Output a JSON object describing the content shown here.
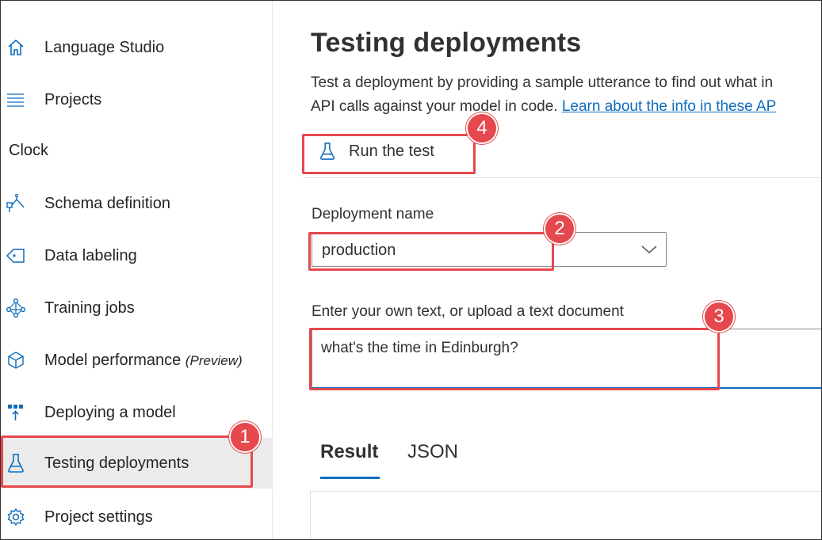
{
  "sidebar": {
    "items": [
      {
        "label": "Language Studio",
        "icon": "home-icon"
      },
      {
        "label": "Projects",
        "icon": "list-icon"
      }
    ],
    "section_title": "Clock",
    "project_items": [
      {
        "label": "Schema definition",
        "icon": "schema-icon"
      },
      {
        "label": "Data labeling",
        "icon": "tag-icon"
      },
      {
        "label": "Training jobs",
        "icon": "network-icon"
      },
      {
        "label": "Model performance",
        "suffix": "(Preview)",
        "icon": "cube-icon"
      },
      {
        "label": "Deploying a model",
        "icon": "deploy-icon"
      },
      {
        "label": "Testing deployments",
        "icon": "flask-icon",
        "active": true
      },
      {
        "label": "Project settings",
        "icon": "gear-icon"
      }
    ]
  },
  "main": {
    "title": "Testing deployments",
    "description_line1": "Test a deployment by providing a sample utterance to find out what in",
    "description_line2": "API calls against your model in code.",
    "learn_link": "Learn about the info in these AP",
    "run_button": "Run the test",
    "deployment_label": "Deployment name",
    "deployment_value": "production",
    "text_label": "Enter your own text, or upload a text document",
    "text_value": "what's the time in Edinburgh?",
    "tabs": [
      {
        "label": "Result",
        "active": true
      },
      {
        "label": "JSON",
        "active": false
      }
    ]
  },
  "annotations": [
    "1",
    "2",
    "3",
    "4"
  ],
  "colors": {
    "accent": "#0f6cbd",
    "annotation": "#e5484d",
    "active_nav_bg": "#ebebeb"
  }
}
